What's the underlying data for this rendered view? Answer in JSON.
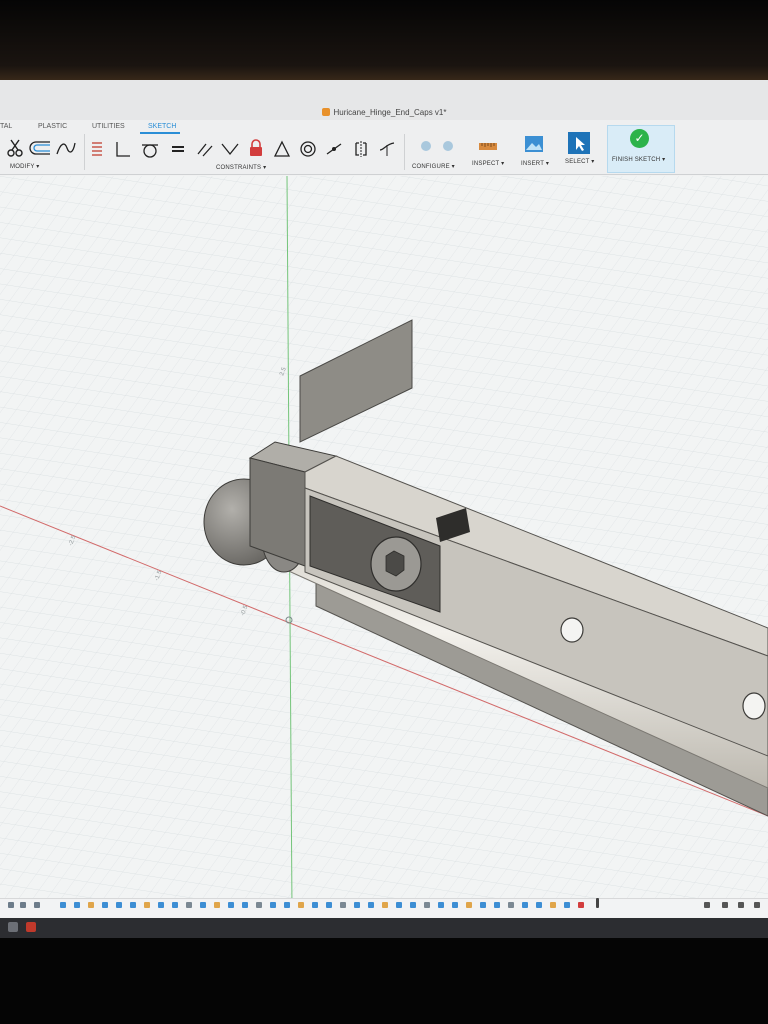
{
  "document": {
    "title": "Huricane_Hinge_End_Caps v1*"
  },
  "tabs": [
    {
      "label": "TAL",
      "active": false
    },
    {
      "label": "PLASTIC",
      "active": false
    },
    {
      "label": "UTILITIES",
      "active": false
    },
    {
      "label": "SKETCH",
      "active": true
    }
  ],
  "toolbar": {
    "groups": {
      "modify": "MODIFY ▾",
      "constraints": "CONSTRAINTS ▾",
      "configure": "CONFIGURE ▾",
      "inspect": "INSPECT ▾",
      "insert": "INSERT ▾",
      "select": "SELECT ▾",
      "finish": "FINISH SKETCH ▾"
    },
    "icons": [
      "scissors-icon",
      "offset-icon",
      "spline-icon",
      "dimension-icon",
      "perpendicular-icon",
      "tangent-icon",
      "equal-icon",
      "parallel-icon",
      "collinear-icon",
      "lock-icon",
      "triangle-icon",
      "concentric-icon",
      "midpoint-icon",
      "symmetry-icon",
      "curvature-icon"
    ]
  },
  "viewport": {
    "dimension_labels": [
      "2.5",
      "-2.5",
      "-1.5",
      "-0.5"
    ],
    "colors": {
      "grid": "#c7cfd3",
      "x_axis": "#d26a6a",
      "y_axis": "#74c47a",
      "part_face": "#8e8c86",
      "tube": "#e8e5dd"
    }
  },
  "taskbar": {},
  "colors": {
    "accent": "#2a8ed6",
    "finish_green": "#2db34a",
    "toolbar_bg": "#eeeff0"
  }
}
